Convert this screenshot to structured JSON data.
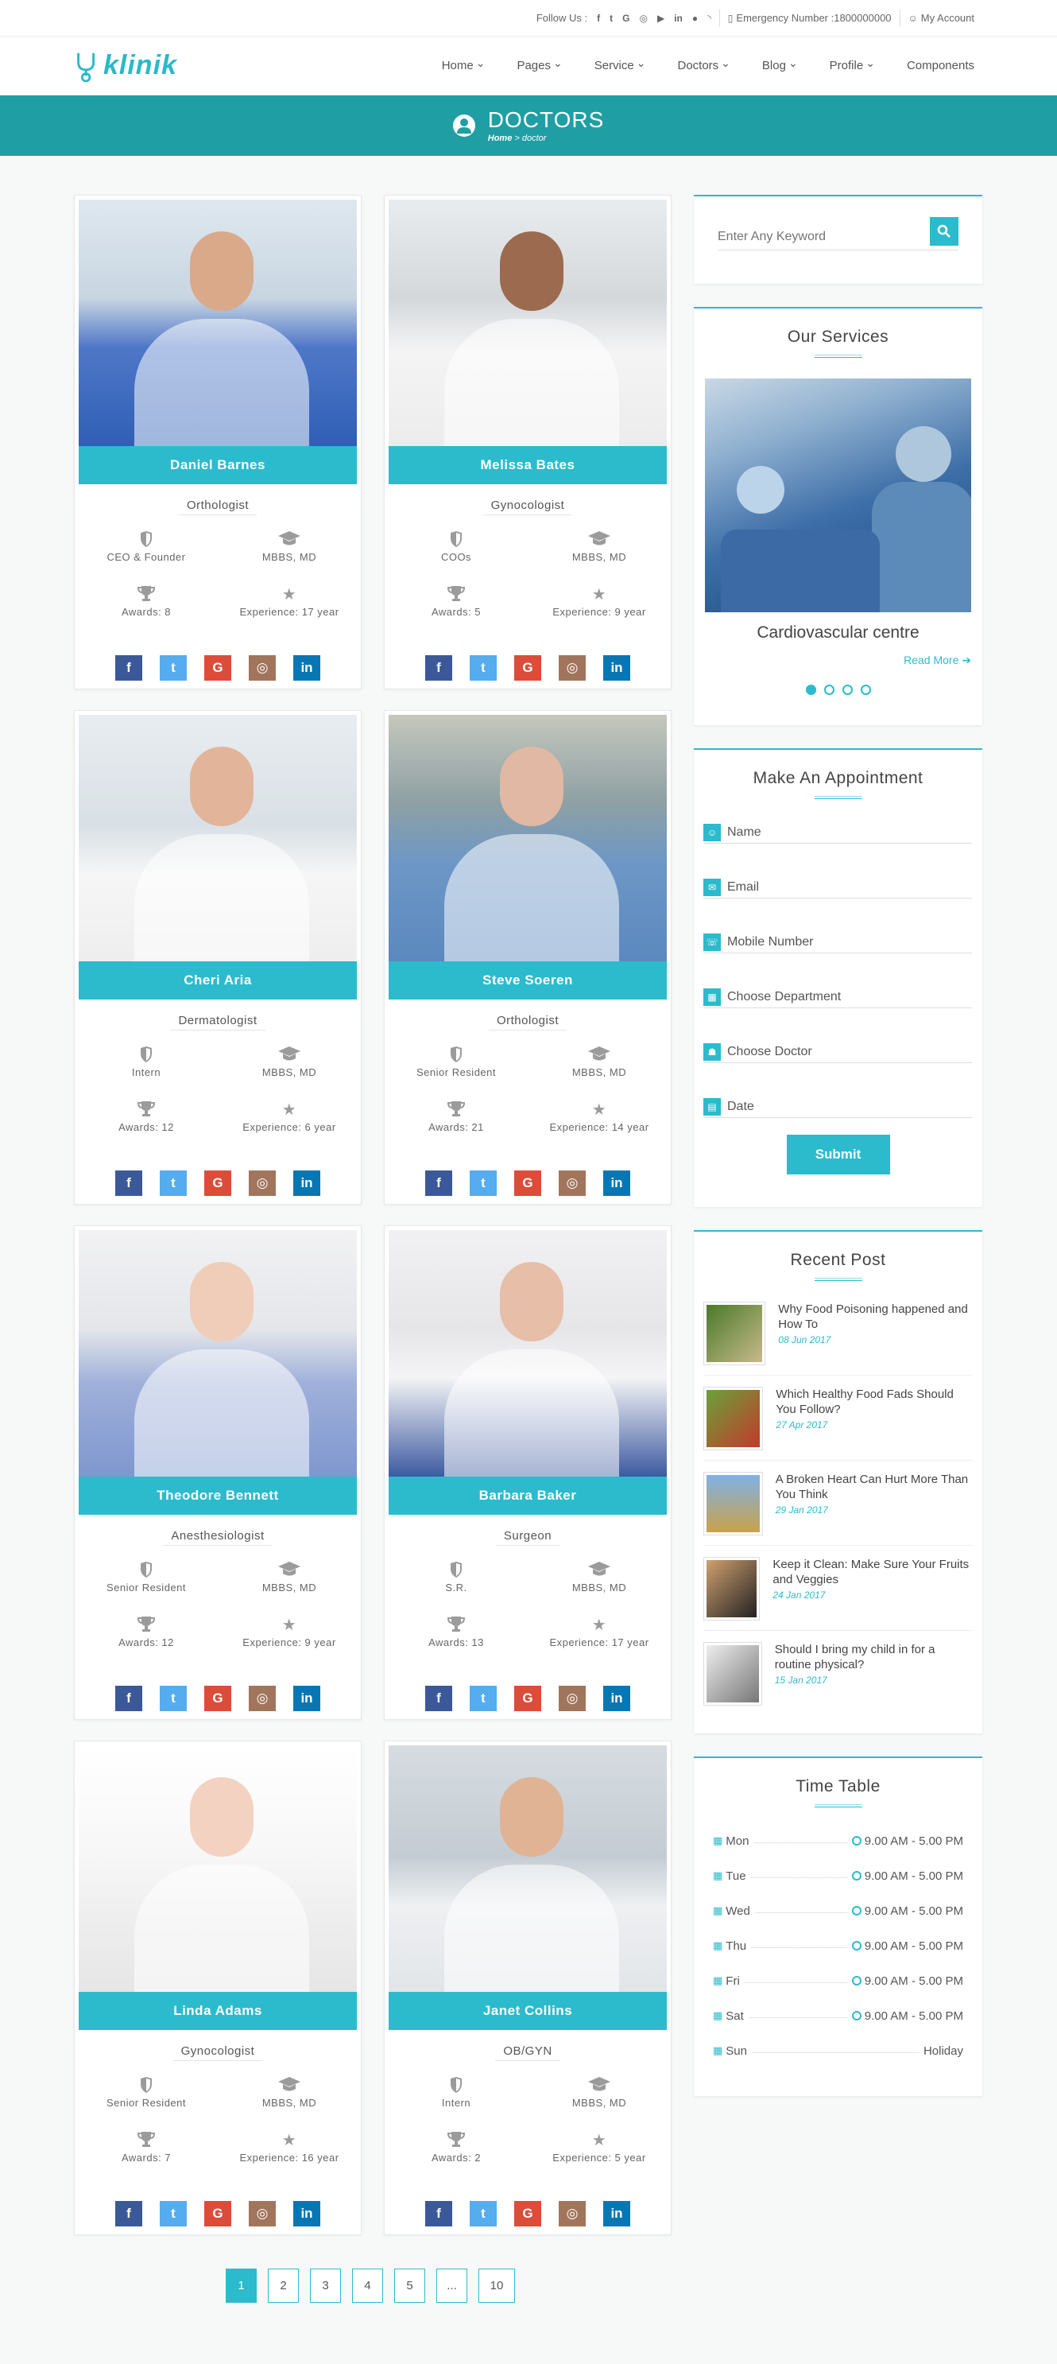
{
  "topbar": {
    "follow_label": "Follow Us :",
    "social_icons": [
      "facebook-icon",
      "twitter-icon",
      "google-icon",
      "instagram-icon",
      "youtube-icon",
      "linkedin-icon",
      "flickr-icon",
      "rss-icon"
    ],
    "emergency_label": "Emergency Number :1800000000",
    "account_label": "My Account"
  },
  "nav": {
    "logo_text": "klinik",
    "items": [
      {
        "label": "Home",
        "dropdown": true
      },
      {
        "label": "Pages",
        "dropdown": true
      },
      {
        "label": "Service",
        "dropdown": true
      },
      {
        "label": "Doctors",
        "dropdown": true
      },
      {
        "label": "Blog",
        "dropdown": true
      },
      {
        "label": "Profile",
        "dropdown": true
      },
      {
        "label": "Components",
        "dropdown": false
      }
    ]
  },
  "banner": {
    "title": "DOCTORS",
    "crumb_home": "Home",
    "crumb_sep": " > ",
    "crumb_current": "doctor"
  },
  "doctors": [
    {
      "name": "Daniel Barnes",
      "specialty": "Orthologist",
      "position": "CEO & Founder",
      "degree": "MBBS, MD",
      "awards": "Awards: 8",
      "experience": "Experience: 17 year"
    },
    {
      "name": "Melissa Bates",
      "specialty": "Gynocologist",
      "position": "COOs",
      "degree": "MBBS, MD",
      "awards": "Awards: 5",
      "experience": "Experience: 9 year"
    },
    {
      "name": "Cheri Aria",
      "specialty": "Dermatologist",
      "position": "Intern",
      "degree": "MBBS, MD",
      "awards": "Awards: 12",
      "experience": "Experience: 6 year"
    },
    {
      "name": "Steve Soeren",
      "specialty": "Orthologist",
      "position": "Senior Resident",
      "degree": "MBBS, MD",
      "awards": "Awards: 21",
      "experience": "Experience: 14 year"
    },
    {
      "name": "Theodore Bennett",
      "specialty": "Anesthesiologist",
      "position": "Senior Resident",
      "degree": "MBBS, MD",
      "awards": "Awards: 12",
      "experience": "Experience: 9 year"
    },
    {
      "name": "Barbara Baker",
      "specialty": "Surgeon",
      "position": "S.R.",
      "degree": "MBBS, MD",
      "awards": "Awards: 13",
      "experience": "Experience: 17 year"
    },
    {
      "name": "Linda Adams",
      "specialty": "Gynocologist",
      "position": "Senior Resident",
      "degree": "MBBS, MD",
      "awards": "Awards: 7",
      "experience": "Experience: 16 year"
    },
    {
      "name": "Janet Collins",
      "specialty": "OB/GYN",
      "position": "Intern",
      "degree": "MBBS, MD",
      "awards": "Awards: 2",
      "experience": "Experience: 5 year"
    }
  ],
  "social_buttons": [
    {
      "name": "facebook",
      "glyph": "f",
      "color": "#3b5998"
    },
    {
      "name": "twitter",
      "glyph": "t",
      "color": "#55acee"
    },
    {
      "name": "google",
      "glyph": "G",
      "color": "#dd4b39"
    },
    {
      "name": "instagram",
      "glyph": "◎",
      "color": "#a1755c"
    },
    {
      "name": "linkedin",
      "glyph": "in",
      "color": "#0976b4"
    }
  ],
  "search": {
    "placeholder": "Enter Any Keyword"
  },
  "services": {
    "title": "Our Services",
    "slide_title": "Cardiovascular centre",
    "read_more": "Read More",
    "slide_count": 4,
    "active_slide": 1
  },
  "appointment": {
    "title": "Make An Appointment",
    "fields": {
      "name": "Name",
      "email": "Email",
      "mobile": "Mobile Number",
      "department": "Choose Department",
      "doctor": "Choose Doctor",
      "date": "Date"
    },
    "submit": "Submit"
  },
  "recent_posts": {
    "title": "Recent Post",
    "items": [
      {
        "title": "Why Food Poisoning happened and How To",
        "date": "08 Jun 2017"
      },
      {
        "title": "Which Healthy Food Fads Should You Follow?",
        "date": "27 Apr 2017"
      },
      {
        "title": "A Broken Heart Can Hurt More Than You Think",
        "date": "29 Jan 2017"
      },
      {
        "title": "Keep it Clean: Make Sure Your Fruits and Veggies",
        "date": "24 Jan 2017"
      },
      {
        "title": "Should I bring my child in for a routine physical?",
        "date": "15 Jan 2017"
      }
    ]
  },
  "timetable": {
    "title": "Time Table",
    "rows": [
      {
        "day": "Mon",
        "time": "9.00 AM - 5.00 PM"
      },
      {
        "day": "Tue",
        "time": "9.00 AM - 5.00 PM"
      },
      {
        "day": "Wed",
        "time": "9.00 AM - 5.00 PM"
      },
      {
        "day": "Thu",
        "time": "9.00 AM - 5.00 PM"
      },
      {
        "day": "Fri",
        "time": "9.00 AM - 5.00 PM"
      },
      {
        "day": "Sat",
        "time": "9.00 AM - 5.00 PM"
      },
      {
        "day": "Sun",
        "time": "Holiday"
      }
    ]
  },
  "pagination": [
    "1",
    "2",
    "3",
    "4",
    "5",
    "...",
    "10"
  ],
  "colors": {
    "accent": "#2bbbcd",
    "banner": "#1f9fa4"
  }
}
